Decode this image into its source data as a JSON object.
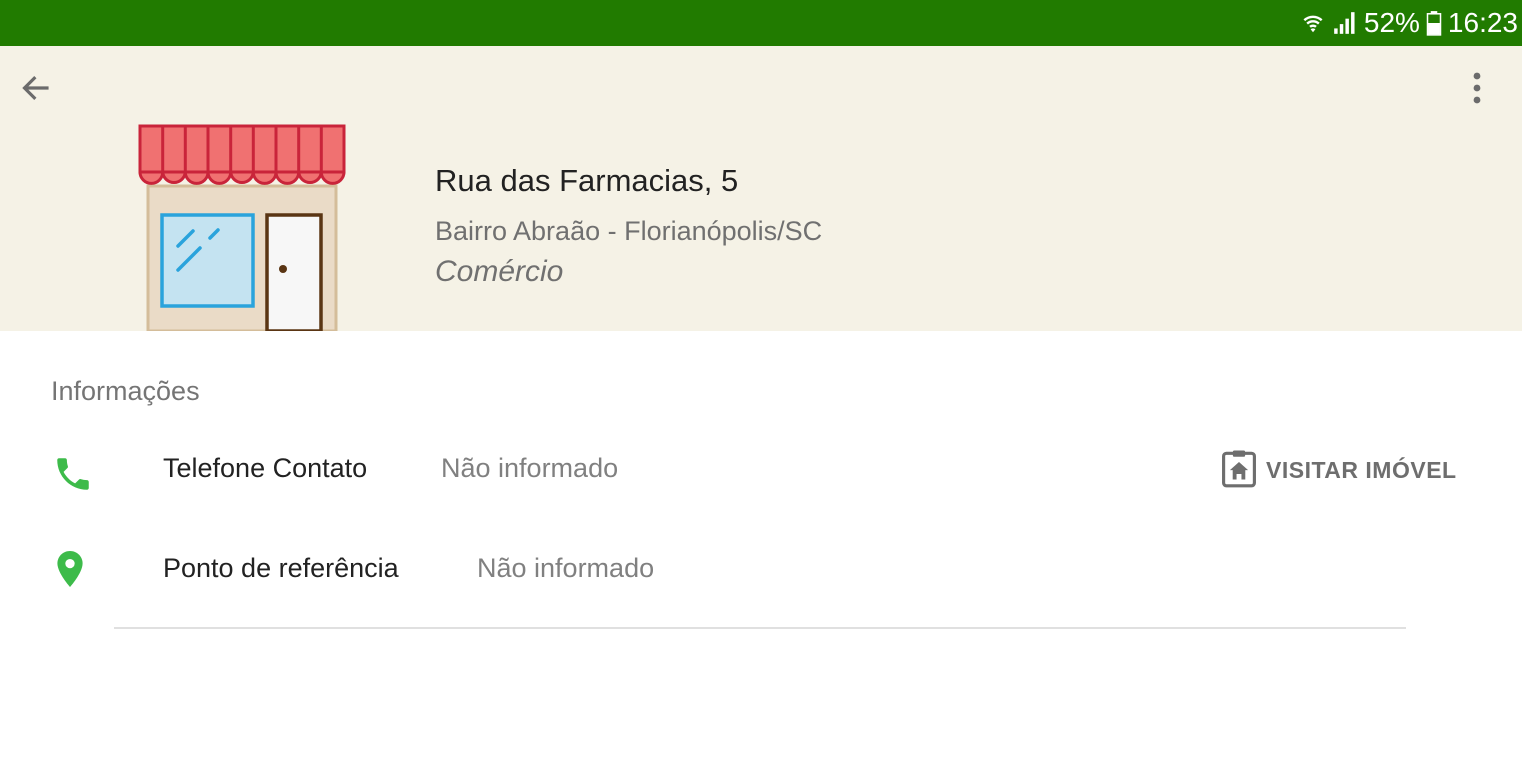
{
  "status_bar": {
    "battery": "52%",
    "time": "16:23",
    "icons": [
      "wifi-icon",
      "signal-icon",
      "battery-icon"
    ],
    "background_color": "#217b00"
  },
  "toolbar": {
    "icons": [
      "back-arrow-icon",
      "more-vert-icon"
    ]
  },
  "property": {
    "address": "Rua das Farmacias, 5",
    "neighborhood": "Bairro Abraão - Florianópolis/SC",
    "type": "Comércio",
    "illustration": "store-icon"
  },
  "info": {
    "title": "Informações",
    "rows": [
      {
        "label": "Telefone Contato",
        "value": "Não informado",
        "icon": "phone-icon"
      },
      {
        "label": "Ponto de referência",
        "value": "Não informado",
        "icon": "location-pin-icon"
      }
    ],
    "action": {
      "label": "VISITAR IMÓVEL",
      "icon": "clipboard-home-icon"
    }
  },
  "colors": {
    "header_bg": "#f5f2e6",
    "accent_green": "#3dbb4a"
  }
}
